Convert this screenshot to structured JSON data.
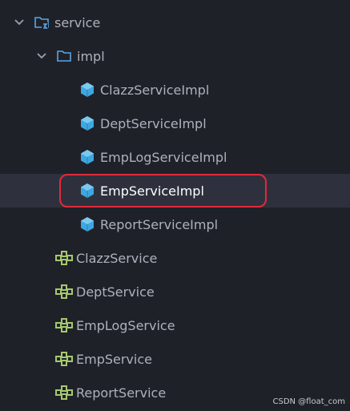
{
  "tree": {
    "service_folder": "service",
    "impl_folder": "impl",
    "impl_items": [
      "ClazzServiceImpl",
      "DeptServiceImpl",
      "EmpLogServiceImpl",
      "EmpServiceImpl",
      "ReportServiceImpl"
    ],
    "interfaces": [
      "ClazzService",
      "DeptService",
      "EmpLogService",
      "EmpService",
      "ReportService"
    ],
    "selected_item": "EmpServiceImpl"
  },
  "colors": {
    "background": "#1f2129",
    "selected_row": "#2e313d",
    "class_icon": "#3ea7e0",
    "interface_icon": "#a6c86e",
    "folder_icon": "#5aa6e6",
    "highlight": "#e12a3a"
  },
  "watermark": "CSDN @float_com"
}
